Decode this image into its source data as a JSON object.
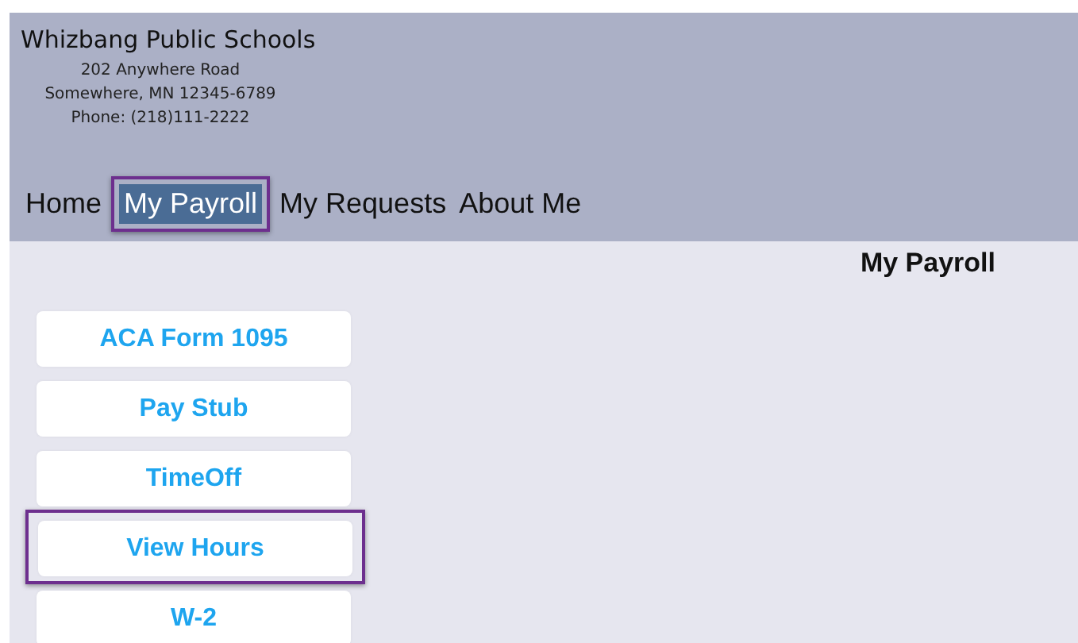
{
  "header": {
    "title": "Whizbang Public Schools",
    "address_lines": [
      "202 Anywhere Road",
      "Somewhere, MN 12345-6789",
      "Phone: (218)111-2222"
    ]
  },
  "nav": [
    {
      "label": "Home",
      "selected": false,
      "highlighted": false
    },
    {
      "label": "My Payroll",
      "selected": true,
      "highlighted": true
    },
    {
      "label": "My Requests",
      "selected": false,
      "highlighted": false
    },
    {
      "label": "About Me",
      "selected": false,
      "highlighted": false
    }
  ],
  "page_title": "My Payroll",
  "menu": [
    {
      "label": "ACA Form 1095",
      "highlighted": false
    },
    {
      "label": "Pay Stub",
      "highlighted": false
    },
    {
      "label": "TimeOff",
      "highlighted": false
    },
    {
      "label": "View Hours",
      "highlighted": true
    },
    {
      "label": "W-2",
      "highlighted": false
    }
  ]
}
